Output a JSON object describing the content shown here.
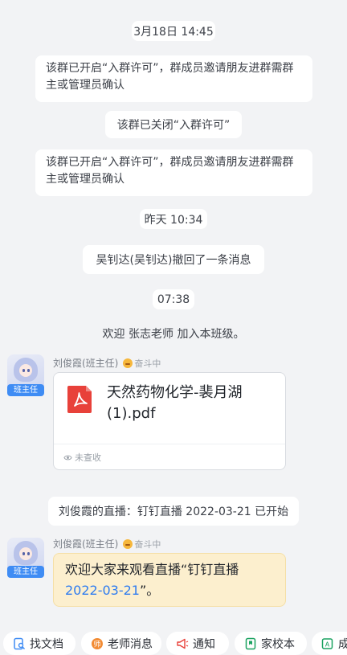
{
  "messages": {
    "time1": "3月18日 14:45",
    "notice_open_1": "该群已开启“入群许可”，群成员邀请朋友进群需群主或管理员确认",
    "notice_closed": "该群已关闭“入群许可”",
    "notice_open_2": "该群已开启“入群许可”，群成员邀请朋友进群需群主或管理员确认",
    "time2": "昨天 10:34",
    "recall": "吴钊达(吴钊达)撤回了一条消息",
    "time3": "07:38",
    "welcome": "欢迎 张志老师 加入本班级。",
    "live_notice": "刘俊霞的直播：钉钉直播 2022-03-21 已开始"
  },
  "sender": {
    "name": "刘俊霞(班主任)",
    "status": "奋斗中",
    "role_badge": "班主任"
  },
  "file_message": {
    "file_name": "天然药物化学-裴月湖(1).pdf",
    "read_status": "未查收",
    "icon": "pdf-icon"
  },
  "live_message": {
    "text_prefix": "欢迎大家来观看直播“钉钉直播",
    "link_text": "2022-03-21",
    "text_suffix": "”。"
  },
  "quickbar": {
    "items": [
      {
        "label": "找文档",
        "icon": "doc-search-icon"
      },
      {
        "label": "老师消息",
        "icon": "teacher-message-icon"
      },
      {
        "label": "通知",
        "icon": "megaphone-icon"
      },
      {
        "label": "家校本",
        "icon": "notebook-icon"
      },
      {
        "label": "成",
        "icon": "grade-icon"
      }
    ]
  },
  "colors": {
    "background": "#f2f3f5",
    "accent": "#3f8cf4",
    "link": "#2e7cf0",
    "live_bubble": "#fcefce",
    "pdf_red": "#e8413a"
  }
}
